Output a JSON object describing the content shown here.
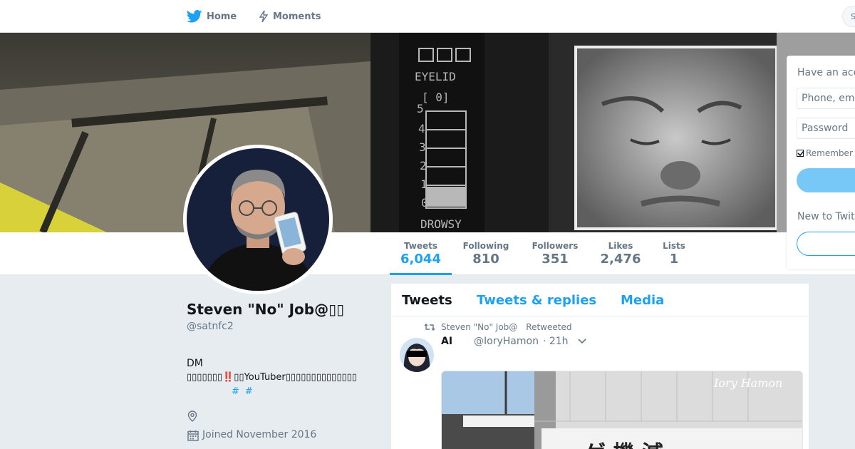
{
  "nav": {
    "home_label": "Home",
    "moments_label": "Moments",
    "search_stub": "S"
  },
  "stats": [
    {
      "label": "Tweets",
      "value": "6,044",
      "active": true
    },
    {
      "label": "Following",
      "value": "810"
    },
    {
      "label": "Followers",
      "value": "351"
    },
    {
      "label": "Likes",
      "value": "2,476"
    },
    {
      "label": "Lists",
      "value": "1"
    }
  ],
  "profile": {
    "name": "Steven \"No\" Job@▯▯",
    "handle": "@satnfc2",
    "bio_line1": "DM",
    "bio_line2": "▯▯▯▯▯▯▯‼️▯▯YouTuber▯▯▯▯▯▯▯▯▯▯▯▯▯▯",
    "hashtag1": "#",
    "hashtag2": "#",
    "joined": "Joined November 2016"
  },
  "banner": {
    "text_eyelid": "EYELID",
    "text_bracket": "[  0]",
    "text_drowsy": "DROWSY",
    "scale": [
      "5",
      "4",
      "3",
      "2",
      "1",
      "0"
    ]
  },
  "timeline": {
    "tabs": [
      "Tweets",
      "Tweets & replies",
      "Media"
    ],
    "retweet_by": "Steven \"No\" Job@",
    "retweeted_label": "Retweeted",
    "tweet_name": "AI",
    "tweet_handle": "@IoryHamon",
    "tweet_time": "· 21h",
    "media_watermark": "Iory Hamon"
  },
  "login": {
    "have_account": "Have an acc",
    "phone_placeholder": "Phone, ema",
    "password_placeholder": "Password",
    "remember": "Remember",
    "new_to": "New to Twit"
  },
  "colors": {
    "accent": "#1da1f2",
    "secondary_text": "#657786",
    "background": "#e6ecf0"
  }
}
